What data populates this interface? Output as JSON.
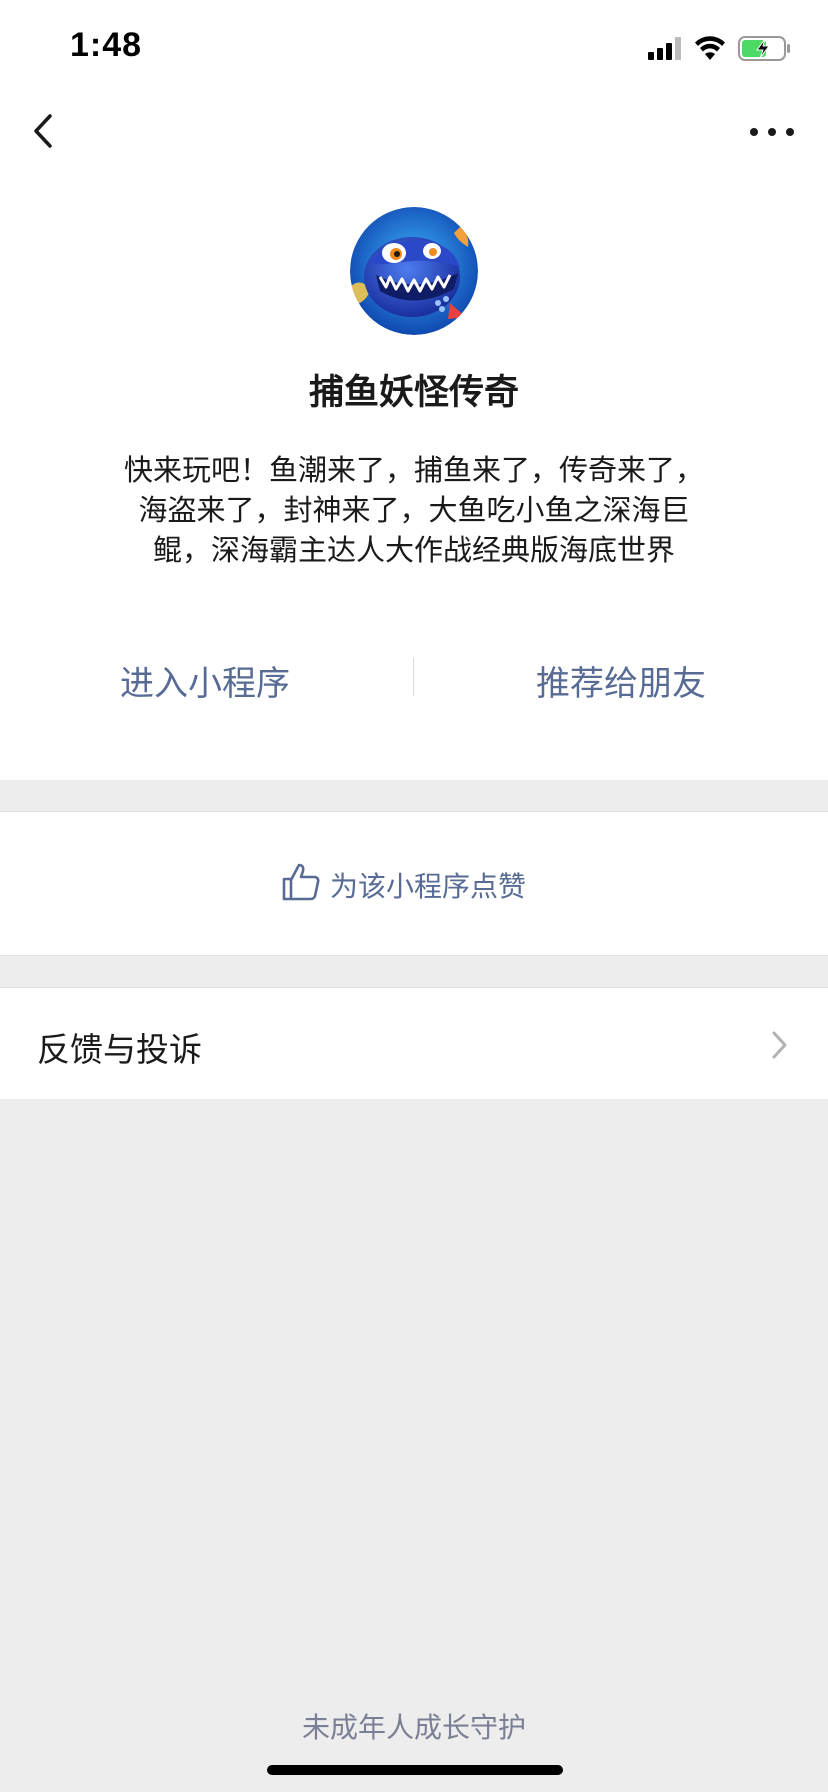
{
  "status_bar": {
    "time": "1:48",
    "signal_icon": "cellular-signal-icon",
    "wifi_icon": "wifi-icon",
    "battery_icon": "battery-charging-icon",
    "battery_color": "#4cd964"
  },
  "nav": {
    "back_icon": "chevron-left-icon",
    "more_icon": "more-dots-icon"
  },
  "app": {
    "avatar_icon": "shark-avatar",
    "name": "捕鱼妖怪传奇",
    "description_lines": [
      "快来玩吧！鱼潮来了，捕鱼来了，传奇来了，",
      "海盗来了，封神来了，大鱼吃小鱼之深海巨",
      "鲲，深海霸主达人大作战经典版海底世界"
    ]
  },
  "actions": {
    "enter_label": "进入小程序",
    "share_label": "推荐给朋友"
  },
  "like": {
    "icon": "thumbs-up-icon",
    "label": "为该小程序点赞"
  },
  "feedback": {
    "label": "反馈与投诉",
    "chevron_icon": "chevron-right-icon"
  },
  "footer": {
    "guard_label": "未成年人成长守护"
  },
  "colors": {
    "link": "#576b95",
    "background": "#ededed",
    "card": "#ffffff"
  }
}
